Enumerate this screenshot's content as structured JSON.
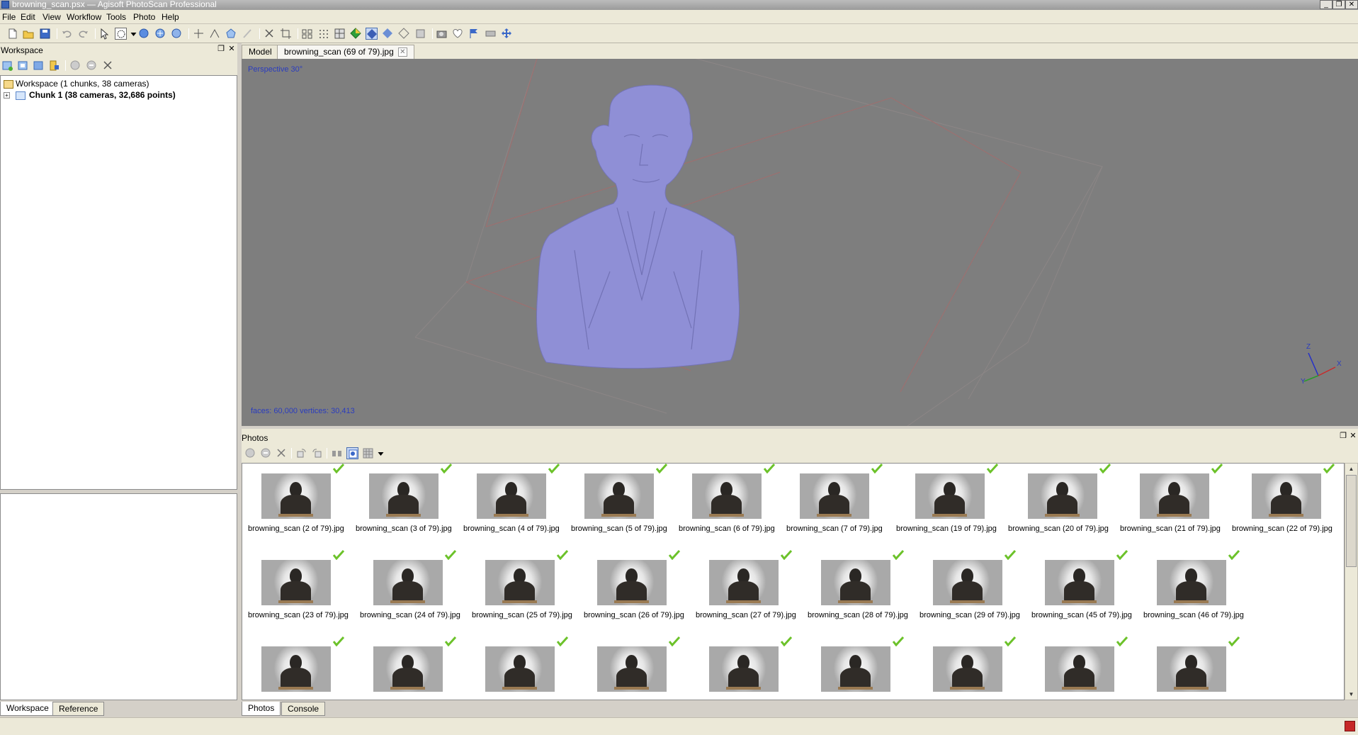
{
  "window": {
    "title": "browning_scan.psx — Agisoft PhotoScan Professional",
    "controls": [
      "minimize",
      "restore",
      "close"
    ]
  },
  "menu": [
    "File",
    "Edit",
    "View",
    "Workflow",
    "Tools",
    "Photo",
    "Help"
  ],
  "workspace": {
    "panel_title": "Workspace",
    "tree": {
      "root": "Workspace (1 chunks, 38 cameras)",
      "chunk": "Chunk 1 (38 cameras, 32,686 points)"
    }
  },
  "bottom_left_tabs": [
    "Workspace",
    "Reference"
  ],
  "model_tabs": [
    "Model",
    "browning_scan (69 of 79).jpg"
  ],
  "viewport": {
    "projection": "Perspective 30°",
    "stats": "faces: 60,000 vertices: 30,413",
    "axes": {
      "x": "X",
      "y": "Y",
      "z": "Z"
    },
    "mesh_color": "#8f8fd6",
    "background_color": "#7e7e7e"
  },
  "photos": {
    "panel_title": "Photos",
    "items": [
      "browning_scan (2 of 79).jpg",
      "browning_scan (3 of 79).jpg",
      "browning_scan (4 of 79).jpg",
      "browning_scan (5 of 79).jpg",
      "browning_scan (6 of 79).jpg",
      "browning_scan (7 of 79).jpg",
      "browning_scan (19 of 79).jpg",
      "browning_scan (20 of 79).jpg",
      "browning_scan (21 of 79).jpg",
      "browning_scan (22 of 79).jpg",
      "browning_scan (23 of 79).jpg",
      "browning_scan (24 of 79).jpg",
      "browning_scan (25 of 79).jpg",
      "browning_scan (26 of 79).jpg",
      "browning_scan (27 of 79).jpg",
      "browning_scan (28 of 79).jpg",
      "browning_scan (29 of 79).jpg",
      "browning_scan (45 of 79).jpg",
      "browning_scan (46 of 79).jpg",
      "",
      "",
      "",
      "",
      "",
      "",
      "",
      "",
      ""
    ],
    "check_color": "#6cc22a"
  },
  "bottom_right_tabs": [
    "Photos",
    "Console"
  ]
}
